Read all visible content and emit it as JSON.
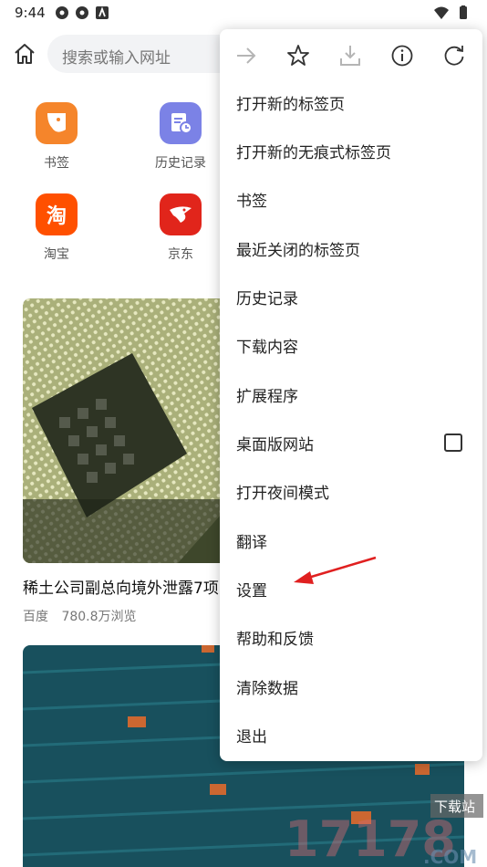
{
  "status_bar": {
    "time": "9:44",
    "icons_left": [
      "settings-icon",
      "settings-icon",
      "notification-icon"
    ],
    "icons_right": [
      "wifi-icon",
      "battery-icon"
    ]
  },
  "address_bar": {
    "home_icon": "home-icon",
    "placeholder": "搜索或输入网址"
  },
  "quick_links": [
    {
      "label": "书签",
      "icon": "bookmark-icon",
      "color": "#f5852b"
    },
    {
      "label": "历史记录",
      "icon": "history-icon",
      "color": "#7b82e6"
    },
    {
      "label": "淘宝",
      "icon": "taobao-icon",
      "color": "#ff5000",
      "glyph": "淘"
    },
    {
      "label": "京东",
      "icon": "jd-icon",
      "color": "#e1251b"
    }
  ],
  "news": {
    "title": "稀土公司副总向境外泄露7项",
    "source": "百度",
    "views": "780.8万浏览"
  },
  "menu": {
    "toolbar": [
      "forward-icon",
      "star-icon",
      "download-icon",
      "info-icon",
      "refresh-icon"
    ],
    "items": [
      {
        "label": "打开新的标签页"
      },
      {
        "label": "打开新的无痕式标签页"
      },
      {
        "label": "书签"
      },
      {
        "label": "最近关闭的标签页"
      },
      {
        "label": "历史记录"
      },
      {
        "label": "下载内容"
      },
      {
        "label": "扩展程序"
      },
      {
        "label": "桌面版网站",
        "checkbox": false
      },
      {
        "label": "打开夜间模式"
      },
      {
        "label": "翻译"
      },
      {
        "label": "设置"
      },
      {
        "label": "帮助和反馈"
      },
      {
        "label": "清除数据"
      },
      {
        "label": "退出"
      }
    ]
  },
  "colors": {
    "annotation_arrow": "#e02020",
    "accent": "#333333"
  },
  "watermark": {
    "text": "17178.COM",
    "badge": "下载站"
  }
}
